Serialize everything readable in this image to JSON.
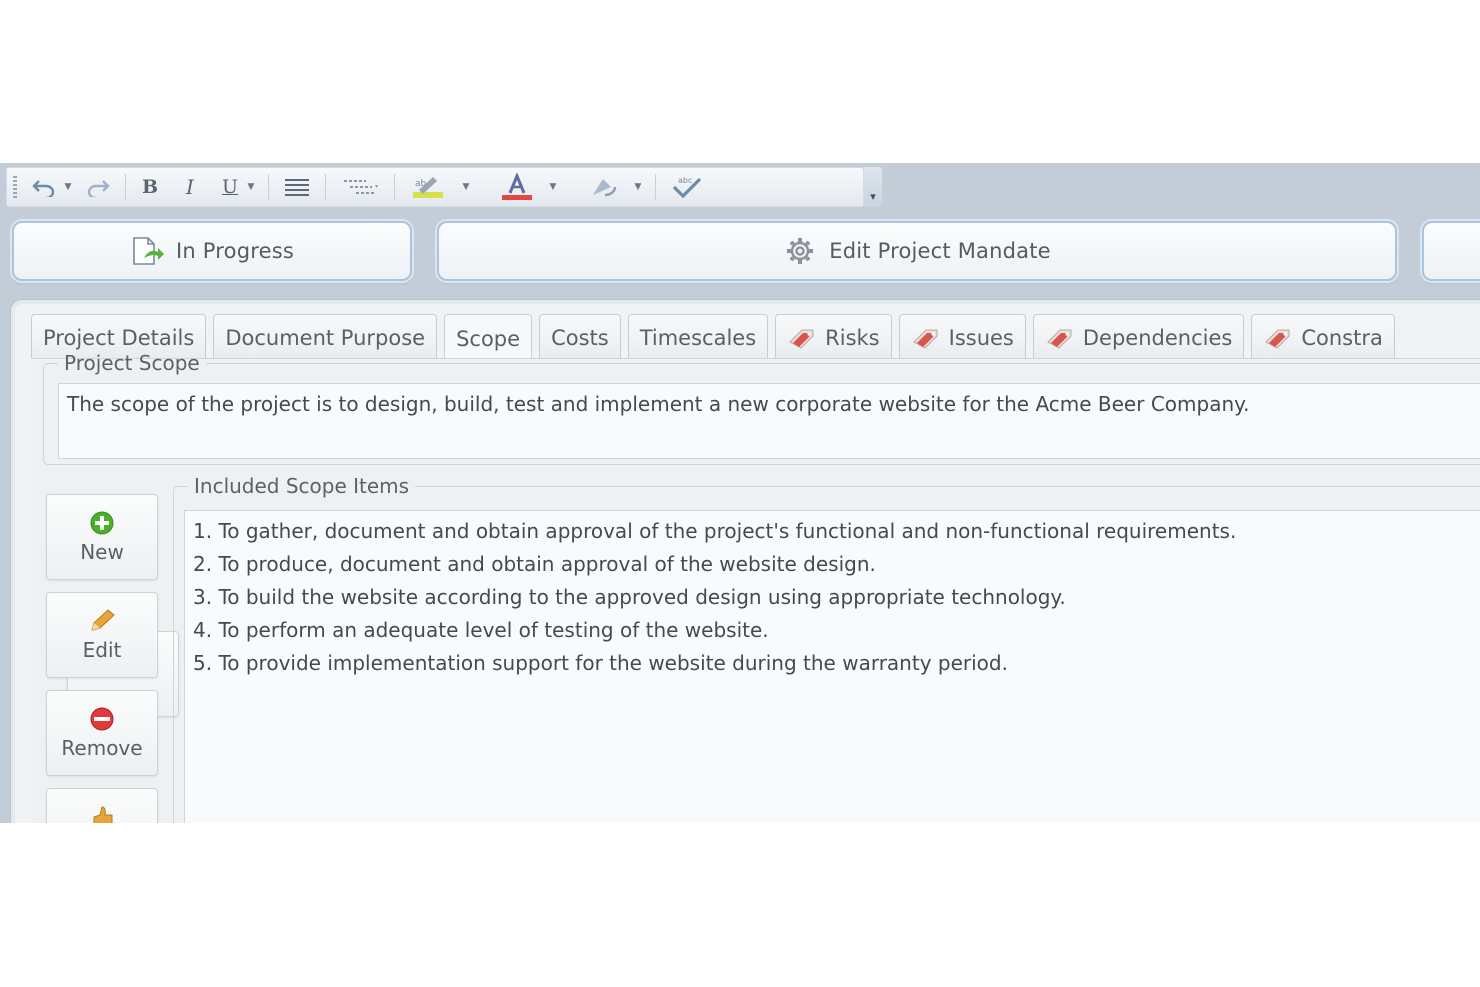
{
  "toolbar": {
    "icons": [
      "undo-icon",
      "redo-icon",
      "bold-icon",
      "italic-icon",
      "underline-icon",
      "align-icon",
      "list-icon",
      "highlight-icon",
      "font-color-icon",
      "style-icon",
      "spellcheck-icon"
    ],
    "bold_glyph": "B",
    "italic_glyph": "I",
    "underline_glyph": "U"
  },
  "actions": {
    "status_label": "In Progress",
    "edit_mandate_label": "Edit Project Mandate"
  },
  "tabs": [
    {
      "label": "Project Details"
    },
    {
      "label": "Document Purpose"
    },
    {
      "label": "Scope"
    },
    {
      "label": "Costs"
    },
    {
      "label": "Timescales"
    },
    {
      "label": "Risks"
    },
    {
      "label": "Issues"
    },
    {
      "label": "Dependencies"
    },
    {
      "label": "Constra"
    }
  ],
  "active_tab": "Scope",
  "project_scope": {
    "legend": "Project Scope",
    "text": "The scope of the project is to design, build, test and implement a new corporate website for the Acme Beer Company."
  },
  "side_buttons": {
    "new_label": "New",
    "edit_label": "Edit",
    "remove_label": "Remove"
  },
  "included_scope": {
    "legend": "Included Scope Items",
    "items": [
      "1. To gather, document and obtain approval of the project's functional and non-functional requirements.",
      "2. To produce, document and obtain approval of the website design.",
      "3. To build the website according to the approved design using appropriate technology.",
      "4. To perform an adequate level of testing of the website.",
      "5. To provide implementation support for the website during the warranty period."
    ]
  },
  "colors": {
    "frame": "#c3cdd8",
    "button_border": "#a9c4de",
    "new_icon": "#4caf2a",
    "remove_icon": "#e03a3a",
    "edit_icon": "#e8a33a",
    "tag_icon": "#d9534f"
  }
}
